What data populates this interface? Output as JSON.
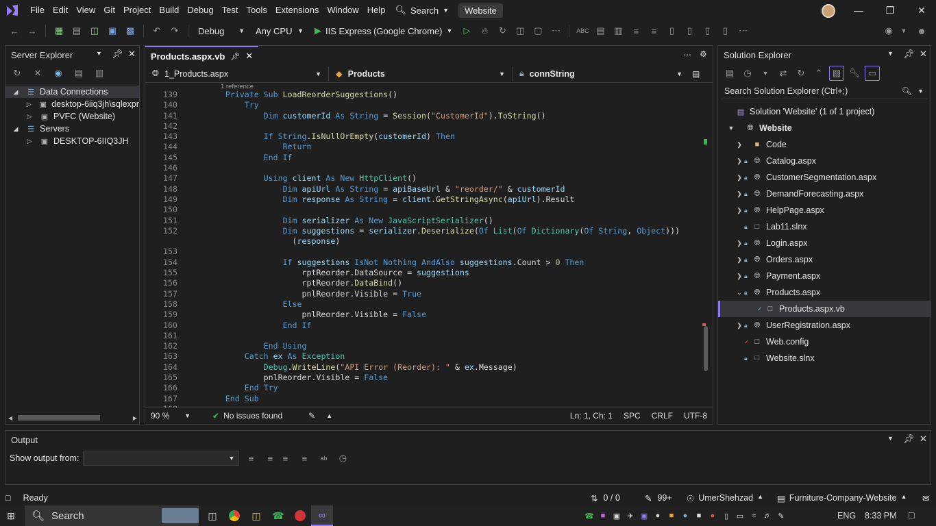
{
  "menubar": {
    "items": [
      "File",
      "Edit",
      "View",
      "Git",
      "Project",
      "Build",
      "Debug",
      "Test",
      "Tools",
      "Extensions",
      "Window",
      "Help"
    ],
    "search_label": "Search",
    "solution_name": "Website"
  },
  "toolbar": {
    "config": "Debug",
    "platform": "Any CPU",
    "run_target": "IIS Express (Google Chrome)"
  },
  "server_explorer": {
    "title": "Server Explorer",
    "rows": [
      {
        "label": "Data Connections",
        "expanded": true,
        "level": 0,
        "selected": true
      },
      {
        "label": "desktop-6iiq3jh\\sqlexpr",
        "expanded": false,
        "level": 1
      },
      {
        "label": "PVFC (Website)",
        "expanded": false,
        "level": 1
      },
      {
        "label": "Servers",
        "expanded": true,
        "level": 0
      },
      {
        "label": "DESKTOP-6IIQ3JH",
        "expanded": false,
        "level": 1
      }
    ]
  },
  "editor": {
    "tab_label": "Products.aspx.vb",
    "nav_project": "1_Products.aspx",
    "nav_class": "Products",
    "nav_member": "connString",
    "codelens": "1 reference",
    "zoom": "90 %",
    "issues": "No issues found",
    "position": "Ln: 1, Ch: 1",
    "whitespace": "SPC",
    "line_ending": "CRLF",
    "encoding": "UTF-8",
    "lines": [
      {
        "n": "139",
        "t": [
          [
            "    ",
            ""
          ],
          [
            "Private Sub ",
            "kw"
          ],
          [
            "LoadReorderSuggestions",
            "fn"
          ],
          [
            "()",
            "id"
          ]
        ]
      },
      {
        "n": "140",
        "t": [
          [
            "        ",
            ""
          ],
          [
            "Try",
            "kw"
          ]
        ]
      },
      {
        "n": "141",
        "t": [
          [
            "            ",
            ""
          ],
          [
            "Dim ",
            "kw"
          ],
          [
            "customerId ",
            "vr"
          ],
          [
            "As ",
            "kw"
          ],
          [
            "String ",
            "kw"
          ],
          [
            "= ",
            "id"
          ],
          [
            "Session",
            "fn"
          ],
          [
            "(",
            "id"
          ],
          [
            "\"CustomerId\"",
            "st"
          ],
          [
            ").",
            "id"
          ],
          [
            "ToString",
            "fn"
          ],
          [
            "()",
            "id"
          ]
        ]
      },
      {
        "n": "142",
        "t": []
      },
      {
        "n": "143",
        "t": [
          [
            "            ",
            ""
          ],
          [
            "If ",
            "kw"
          ],
          [
            "String",
            "kw"
          ],
          [
            ".",
            "id"
          ],
          [
            "IsNullOrEmpty",
            "fn"
          ],
          [
            "(",
            "id"
          ],
          [
            "customerId",
            "vr"
          ],
          [
            ") ",
            "id"
          ],
          [
            "Then",
            "kw"
          ]
        ]
      },
      {
        "n": "144",
        "t": [
          [
            "                ",
            ""
          ],
          [
            "Return",
            "kw"
          ]
        ]
      },
      {
        "n": "145",
        "t": [
          [
            "            ",
            ""
          ],
          [
            "End If",
            "kw"
          ]
        ]
      },
      {
        "n": "146",
        "t": []
      },
      {
        "n": "147",
        "t": [
          [
            "            ",
            ""
          ],
          [
            "Using ",
            "kw"
          ],
          [
            "client ",
            "vr"
          ],
          [
            "As New ",
            "kw"
          ],
          [
            "HttpClient",
            "ty"
          ],
          [
            "()",
            "id"
          ]
        ]
      },
      {
        "n": "148",
        "t": [
          [
            "                ",
            ""
          ],
          [
            "Dim ",
            "kw"
          ],
          [
            "apiUrl ",
            "vr"
          ],
          [
            "As ",
            "kw"
          ],
          [
            "String ",
            "kw"
          ],
          [
            "= ",
            "id"
          ],
          [
            "apiBaseUrl ",
            "vr"
          ],
          [
            "& ",
            "id"
          ],
          [
            "\"reorder/\" ",
            "st"
          ],
          [
            "& ",
            "id"
          ],
          [
            "customerId",
            "vr"
          ]
        ]
      },
      {
        "n": "149",
        "t": [
          [
            "                ",
            ""
          ],
          [
            "Dim ",
            "kw"
          ],
          [
            "response ",
            "vr"
          ],
          [
            "As ",
            "kw"
          ],
          [
            "String ",
            "kw"
          ],
          [
            "= ",
            "id"
          ],
          [
            "client",
            "vr"
          ],
          [
            ".",
            "id"
          ],
          [
            "GetStringAsync",
            "fn"
          ],
          [
            "(",
            "id"
          ],
          [
            "apiUrl",
            "vr"
          ],
          [
            ").",
            "id"
          ],
          [
            "Result",
            "id"
          ]
        ]
      },
      {
        "n": "150",
        "t": []
      },
      {
        "n": "151",
        "t": [
          [
            "                ",
            ""
          ],
          [
            "Dim ",
            "kw"
          ],
          [
            "serializer ",
            "vr"
          ],
          [
            "As New ",
            "kw"
          ],
          [
            "JavaScriptSerializer",
            "ty"
          ],
          [
            "()",
            "id"
          ]
        ]
      },
      {
        "n": "152",
        "t": [
          [
            "                ",
            ""
          ],
          [
            "Dim ",
            "kw"
          ],
          [
            "suggestions ",
            "vr"
          ],
          [
            "= ",
            "id"
          ],
          [
            "serializer",
            "vr"
          ],
          [
            ".",
            "id"
          ],
          [
            "Deserialize",
            "fn"
          ],
          [
            "(",
            "id"
          ],
          [
            "Of ",
            "kw"
          ],
          [
            "List",
            "ty"
          ],
          [
            "(",
            "id"
          ],
          [
            "Of ",
            "kw"
          ],
          [
            "Dictionary",
            "ty"
          ],
          [
            "(",
            "id"
          ],
          [
            "Of ",
            "kw"
          ],
          [
            "String",
            "kw"
          ],
          [
            ", ",
            "id"
          ],
          [
            "Object",
            "kw"
          ],
          [
            ")))",
            "id"
          ]
        ]
      },
      {
        "n": "",
        "t": [
          [
            "                  ",
            ""
          ],
          [
            "(",
            "id"
          ],
          [
            "response",
            "vr"
          ],
          [
            ")",
            "id"
          ]
        ]
      },
      {
        "n": "153",
        "t": []
      },
      {
        "n": "154",
        "t": [
          [
            "                ",
            ""
          ],
          [
            "If ",
            "kw"
          ],
          [
            "suggestions ",
            "vr"
          ],
          [
            "IsNot Nothing AndAlso ",
            "kw"
          ],
          [
            "suggestions",
            "vr"
          ],
          [
            ".",
            "id"
          ],
          [
            "Count ",
            "id"
          ],
          [
            "> ",
            "id"
          ],
          [
            "0 ",
            "nu"
          ],
          [
            "Then",
            "kw"
          ]
        ]
      },
      {
        "n": "155",
        "t": [
          [
            "                    ",
            ""
          ],
          [
            "rptReorder",
            "id"
          ],
          [
            ".",
            "id"
          ],
          [
            "DataSource ",
            "id"
          ],
          [
            "= ",
            "id"
          ],
          [
            "suggestions",
            "vr"
          ]
        ]
      },
      {
        "n": "156",
        "t": [
          [
            "                    ",
            ""
          ],
          [
            "rptReorder",
            "id"
          ],
          [
            ".",
            "id"
          ],
          [
            "DataBind",
            "fn"
          ],
          [
            "()",
            "id"
          ]
        ]
      },
      {
        "n": "157",
        "t": [
          [
            "                    ",
            ""
          ],
          [
            "pnlReorder",
            "id"
          ],
          [
            ".",
            "id"
          ],
          [
            "Visible ",
            "id"
          ],
          [
            "= ",
            "id"
          ],
          [
            "True",
            "kw"
          ]
        ]
      },
      {
        "n": "158",
        "t": [
          [
            "                ",
            ""
          ],
          [
            "Else",
            "kw"
          ]
        ]
      },
      {
        "n": "159",
        "t": [
          [
            "                    ",
            ""
          ],
          [
            "pnlReorder",
            "id"
          ],
          [
            ".",
            "id"
          ],
          [
            "Visible ",
            "id"
          ],
          [
            "= ",
            "id"
          ],
          [
            "False",
            "kw"
          ]
        ]
      },
      {
        "n": "160",
        "t": [
          [
            "                ",
            ""
          ],
          [
            "End If",
            "kw"
          ]
        ]
      },
      {
        "n": "161",
        "t": []
      },
      {
        "n": "162",
        "t": [
          [
            "            ",
            ""
          ],
          [
            "End Using",
            "kw"
          ]
        ]
      },
      {
        "n": "163",
        "t": [
          [
            "        ",
            ""
          ],
          [
            "Catch ",
            "kw"
          ],
          [
            "ex ",
            "vr"
          ],
          [
            "As ",
            "kw"
          ],
          [
            "Exception",
            "ty"
          ]
        ]
      },
      {
        "n": "164",
        "t": [
          [
            "            ",
            ""
          ],
          [
            "Debug",
            "ty"
          ],
          [
            ".",
            "id"
          ],
          [
            "WriteLine",
            "fn"
          ],
          [
            "(",
            "id"
          ],
          [
            "\"API Error (Reorder): \" ",
            "st"
          ],
          [
            "& ",
            "id"
          ],
          [
            "ex",
            "vr"
          ],
          [
            ".",
            "id"
          ],
          [
            "Message",
            "id"
          ],
          [
            ")",
            "id"
          ]
        ]
      },
      {
        "n": "165",
        "t": [
          [
            "            ",
            ""
          ],
          [
            "pnlReorder",
            "id"
          ],
          [
            ".",
            "id"
          ],
          [
            "Visible ",
            "id"
          ],
          [
            "= ",
            "id"
          ],
          [
            "False",
            "kw"
          ]
        ]
      },
      {
        "n": "166",
        "t": [
          [
            "        ",
            ""
          ],
          [
            "End Try",
            "kw"
          ]
        ]
      },
      {
        "n": "167",
        "t": [
          [
            "    ",
            ""
          ],
          [
            "End Sub",
            "kw"
          ]
        ]
      },
      {
        "n": "168",
        "t": []
      }
    ]
  },
  "solution_explorer": {
    "title": "Solution Explorer",
    "search_placeholder": "Search Solution Explorer (Ctrl+;)",
    "solution_label": "Solution 'Website' (1 of 1 project)",
    "project": "Website",
    "items": [
      {
        "label": "Code",
        "type": "folder",
        "caret": "right",
        "level": 2
      },
      {
        "label": "Catalog.aspx",
        "type": "aspx",
        "caret": "right",
        "level": 2
      },
      {
        "label": "CustomerSegmentation.aspx",
        "type": "aspx",
        "caret": "right",
        "level": 2
      },
      {
        "label": "DemandForecasting.aspx",
        "type": "aspx",
        "caret": "right",
        "level": 2
      },
      {
        "label": "HelpPage.aspx",
        "type": "aspx",
        "caret": "right",
        "level": 2
      },
      {
        "label": "Lab11.slnx",
        "type": "file",
        "caret": "",
        "level": 2
      },
      {
        "label": "Login.aspx",
        "type": "aspx",
        "caret": "right",
        "level": 2
      },
      {
        "label": "Orders.aspx",
        "type": "aspx",
        "caret": "right",
        "level": 2
      },
      {
        "label": "Payment.aspx",
        "type": "aspx",
        "caret": "right",
        "level": 2
      },
      {
        "label": "Products.aspx",
        "type": "aspx",
        "caret": "down",
        "level": 2
      },
      {
        "label": "Products.aspx.vb",
        "type": "vb",
        "caret": "",
        "level": 3,
        "selected": true
      },
      {
        "label": "UserRegistration.aspx",
        "type": "aspx",
        "caret": "right",
        "level": 2
      },
      {
        "label": "Web.config",
        "type": "config",
        "caret": "",
        "level": 2
      },
      {
        "label": "Website.slnx",
        "type": "file",
        "caret": "",
        "level": 2
      }
    ]
  },
  "output": {
    "title": "Output",
    "show_from_label": "Show output from:"
  },
  "statusbar": {
    "ready": "Ready",
    "sync": "0 / 0",
    "changes": "99+",
    "user": "UmerShehzad",
    "repo": "Furniture-Company-Website"
  },
  "taskbar": {
    "search": "Search",
    "lang": "ENG",
    "time": "8:33 PM"
  },
  "colors": {
    "accent": "#8f7cf0",
    "run_green": "#3fb950",
    "keyword": "#569cd6",
    "type": "#4ec9b0",
    "string": "#d69d85"
  }
}
